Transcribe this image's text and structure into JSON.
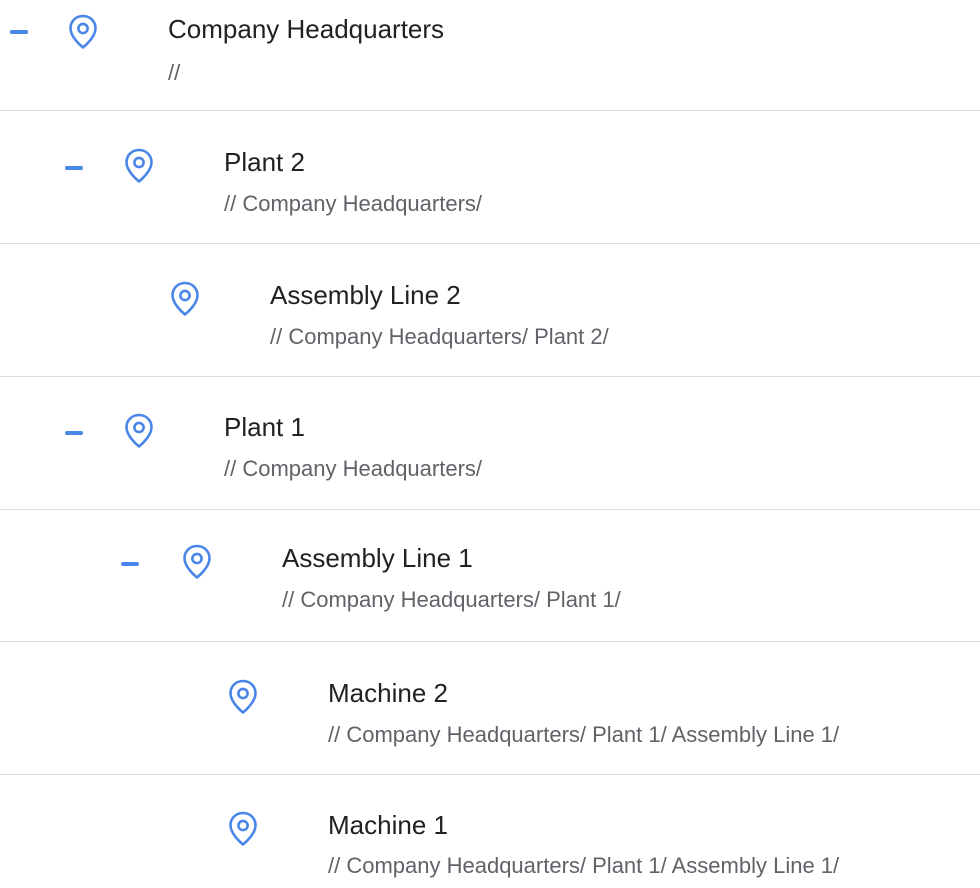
{
  "tree": {
    "accent_color": "#4a86e8",
    "nodes": [
      {
        "name": "Company Headquarters",
        "path": "//",
        "expanded": true,
        "icon": "location-pin-icon"
      },
      {
        "name": "Plant 2",
        "path": "// Company Headquarters/",
        "expanded": true,
        "icon": "location-pin-icon"
      },
      {
        "name": "Assembly Line 2",
        "path": "// Company Headquarters/ Plant 2/",
        "expanded": false,
        "icon": "location-pin-icon"
      },
      {
        "name": "Plant 1",
        "path": "// Company Headquarters/",
        "expanded": true,
        "icon": "location-pin-icon"
      },
      {
        "name": "Assembly Line 1",
        "path": "// Company Headquarters/ Plant 1/",
        "expanded": true,
        "icon": "location-pin-icon"
      },
      {
        "name": "Machine 2",
        "path": "// Company Headquarters/ Plant 1/ Assembly Line 1/",
        "expanded": false,
        "icon": "location-pin-icon"
      },
      {
        "name": "Machine 1",
        "path": "// Company Headquarters/ Plant 1/ Assembly Line 1/",
        "expanded": false,
        "icon": "location-pin-icon"
      }
    ]
  }
}
